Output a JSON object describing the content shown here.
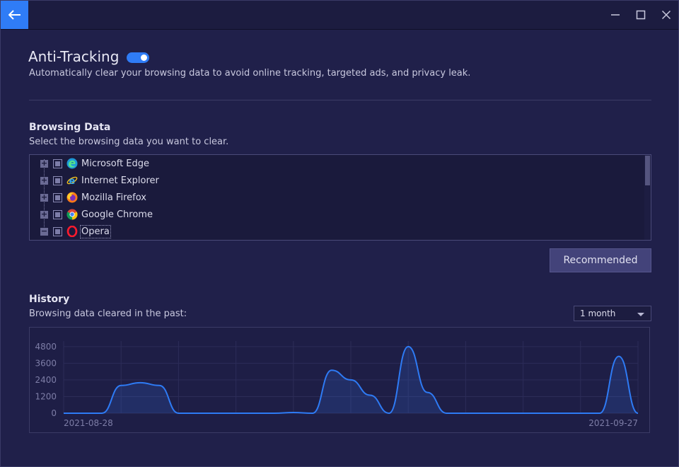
{
  "header": {
    "title": "Anti-Tracking",
    "toggle_on": true,
    "subtitle": "Automatically clear your browsing data to avoid online tracking, targeted ads, and privacy leak."
  },
  "browsing_data": {
    "title": "Browsing Data",
    "description": "Select the browsing data you want to clear.",
    "browsers": [
      {
        "label": "Microsoft Edge",
        "expander": "+",
        "icon": "edge-icon"
      },
      {
        "label": "Internet Explorer",
        "expander": "+",
        "icon": "internet-explorer-icon"
      },
      {
        "label": "Mozilla Firefox",
        "expander": "+",
        "icon": "firefox-icon"
      },
      {
        "label": "Google Chrome",
        "expander": "+",
        "icon": "chrome-icon"
      },
      {
        "label": "Opera",
        "expander": "−",
        "icon": "opera-icon"
      }
    ],
    "recommended_label": "Recommended"
  },
  "history": {
    "title": "History",
    "description": "Browsing data cleared in the past:",
    "period": "1 month"
  },
  "colors": {
    "accent": "#2f7cf6",
    "background": "#20204a",
    "line": "#2e7bf5"
  },
  "chart_data": {
    "type": "area",
    "x_start_label": "2021-08-28",
    "x_end_label": "2021-09-27",
    "x": [
      "2021-08-28",
      "2021-08-29",
      "2021-08-30",
      "2021-08-31",
      "2021-09-01",
      "2021-09-02",
      "2021-09-03",
      "2021-09-04",
      "2021-09-05",
      "2021-09-06",
      "2021-09-07",
      "2021-09-08",
      "2021-09-09",
      "2021-09-10",
      "2021-09-11",
      "2021-09-12",
      "2021-09-13",
      "2021-09-14",
      "2021-09-15",
      "2021-09-16",
      "2021-09-17",
      "2021-09-18",
      "2021-09-19",
      "2021-09-20",
      "2021-09-21",
      "2021-09-22",
      "2021-09-23",
      "2021-09-24",
      "2021-09-25",
      "2021-09-26",
      "2021-09-27"
    ],
    "values": [
      0,
      0,
      0,
      2000,
      2200,
      2000,
      0,
      0,
      0,
      0,
      0,
      0,
      50,
      0,
      3100,
      2400,
      1300,
      0,
      4800,
      1500,
      0,
      0,
      0,
      0,
      0,
      0,
      0,
      0,
      0,
      4100,
      0
    ],
    "yticks": [
      0,
      1200,
      2400,
      3600,
      4800
    ],
    "ylim": [
      0,
      5200
    ],
    "grid": true
  }
}
